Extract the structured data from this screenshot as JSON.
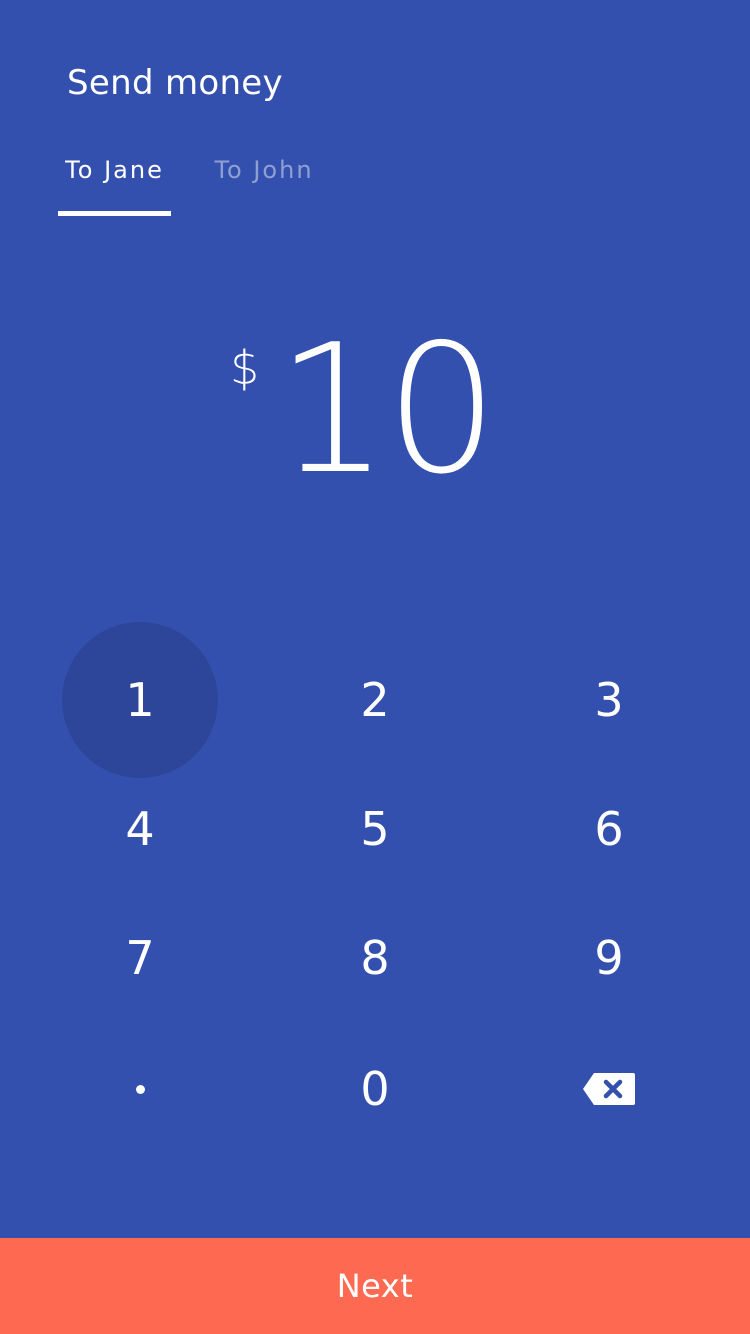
{
  "header": {
    "title": "Send money"
  },
  "tabs": [
    {
      "label": "To Jane",
      "active": true
    },
    {
      "label": "To John",
      "active": false
    }
  ],
  "amount": {
    "currency_symbol": "$",
    "value": "10"
  },
  "keypad": {
    "keys": [
      "1",
      "2",
      "3",
      "4",
      "5",
      "6",
      "7",
      "8",
      "9",
      "·",
      "0"
    ],
    "pressed_key": "1",
    "decimal_icon": "dot-icon",
    "delete_icon": "backspace-icon"
  },
  "action": {
    "next_label": "Next"
  },
  "colors": {
    "background": "#3450AE",
    "pressed_key": "#2D469A",
    "next_button": "#FE6A51",
    "text": "#FFFFFF"
  }
}
